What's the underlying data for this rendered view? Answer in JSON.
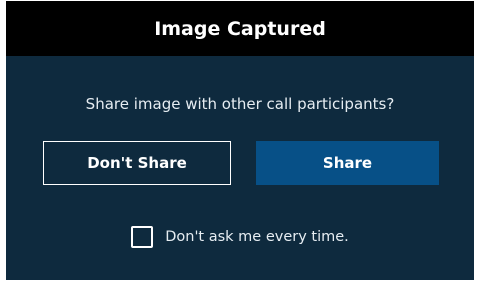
{
  "dialog": {
    "title": "Image Captured",
    "prompt": "Share image with other call participants?",
    "dont_share_label": "Don't Share",
    "share_label": "Share",
    "checkbox_label": "Don't ask me every time.",
    "checkbox_checked": false
  },
  "colors": {
    "title_bar": "#000000",
    "dialog_background": "#0e2a3e",
    "primary_button": "#075087",
    "text": "#ffffff"
  }
}
